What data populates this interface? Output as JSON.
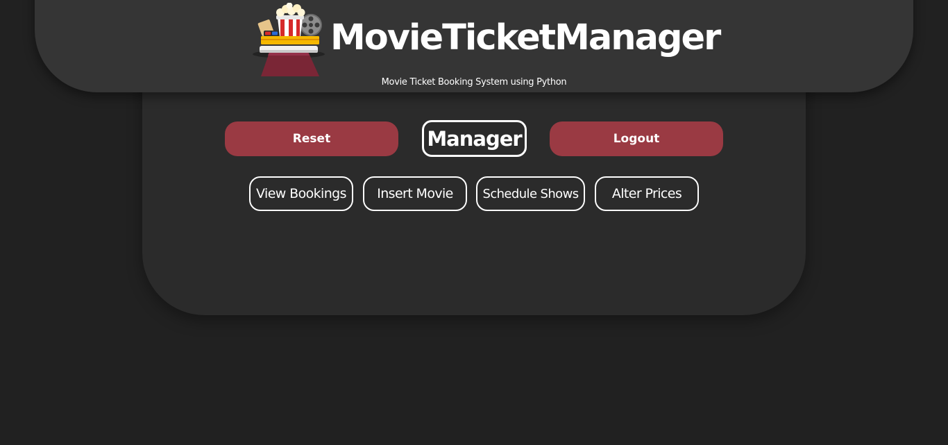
{
  "header": {
    "title": "MovieTicketManager",
    "subtitle": "Movie Ticket Booking System using Python",
    "logo_icon": "cinema-popcorn-logo-icon"
  },
  "actions": {
    "reset_label": "Reset",
    "role_label": "Manager",
    "logout_label": "Logout"
  },
  "nav": {
    "items": [
      {
        "label": "View Bookings"
      },
      {
        "label": "Insert Movie"
      },
      {
        "label": "Schedule Shows"
      },
      {
        "label": "Alter Prices"
      }
    ]
  },
  "colors": {
    "background": "#212121",
    "panel": "#2b2b2b",
    "header": "#353535",
    "accent": "#9a3a43",
    "text": "#ffffff"
  }
}
